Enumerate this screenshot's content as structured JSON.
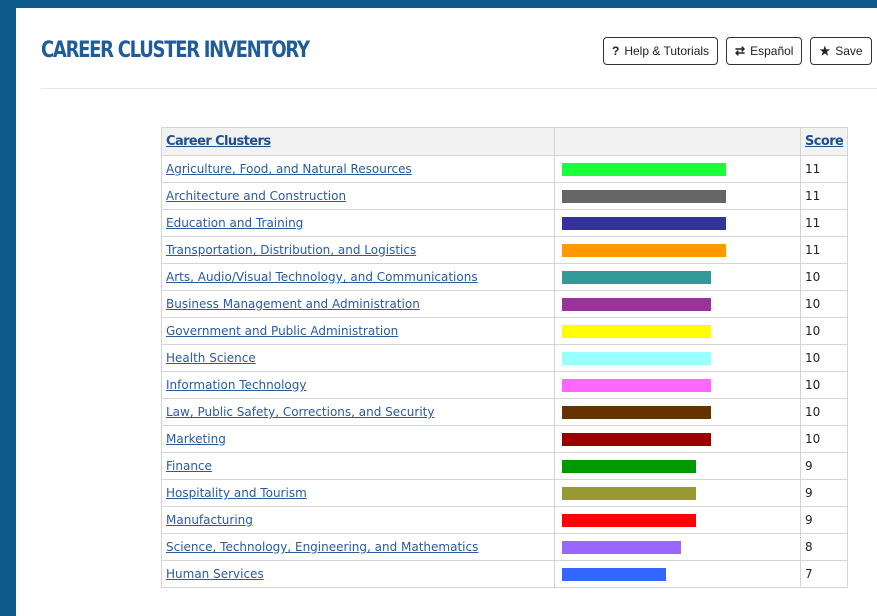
{
  "header": {
    "title": "CAREER CLUSTER INVENTORY",
    "buttons": [
      {
        "icon": "help-icon",
        "glyph": "?",
        "label": "Help & Tutorials"
      },
      {
        "icon": "swap-icon",
        "glyph": "⇄",
        "label": "Español"
      },
      {
        "icon": "star-icon",
        "glyph": "★",
        "label": "Save"
      }
    ]
  },
  "table": {
    "col_name": "Career Clusters",
    "col_score": "Score",
    "max_score": 11,
    "rows": [
      {
        "name": "Agriculture, Food, and Natural Resources",
        "score": 11,
        "color": "#1aff3a"
      },
      {
        "name": "Architecture and Construction",
        "score": 11,
        "color": "#666666"
      },
      {
        "name": "Education and Training",
        "score": 11,
        "color": "#333399"
      },
      {
        "name": "Transportation, Distribution, and Logistics",
        "score": 11,
        "color": "#ff9900"
      },
      {
        "name": "Arts, Audio/Visual Technology, and Communications",
        "score": 10,
        "color": "#339999"
      },
      {
        "name": "Business Management and Administration",
        "score": 10,
        "color": "#993399"
      },
      {
        "name": "Government and Public Administration",
        "score": 10,
        "color": "#ffff00"
      },
      {
        "name": "Health Science",
        "score": 10,
        "color": "#99ffff"
      },
      {
        "name": "Information Technology",
        "score": 10,
        "color": "#ff66ff"
      },
      {
        "name": "Law, Public Safety, Corrections, and Security",
        "score": 10,
        "color": "#663300"
      },
      {
        "name": "Marketing",
        "score": 10,
        "color": "#990000"
      },
      {
        "name": "Finance",
        "score": 9,
        "color": "#009900"
      },
      {
        "name": "Hospitality and Tourism",
        "score": 9,
        "color": "#999933"
      },
      {
        "name": "Manufacturing",
        "score": 9,
        "color": "#ff0000"
      },
      {
        "name": "Science, Technology, Engineering, and Mathematics",
        "score": 8,
        "color": "#9966ff"
      },
      {
        "name": "Human Services",
        "score": 7,
        "color": "#3366ff"
      }
    ]
  }
}
